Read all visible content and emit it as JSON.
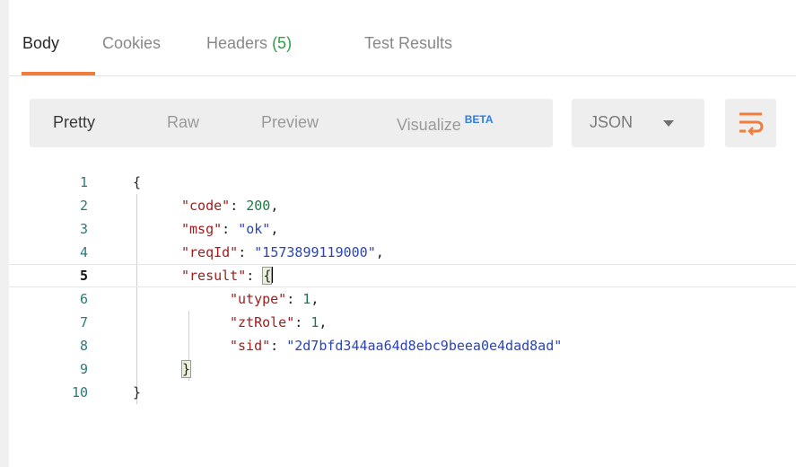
{
  "tabs": [
    {
      "label": "Body",
      "active": true
    },
    {
      "label": "Cookies",
      "active": false
    },
    {
      "label": "Headers",
      "count": "(5)",
      "active": false
    },
    {
      "label": "Test Results",
      "active": false
    }
  ],
  "view_modes": [
    {
      "label": "Pretty",
      "active": true
    },
    {
      "label": "Raw",
      "active": false
    },
    {
      "label": "Preview",
      "active": false
    },
    {
      "label": "Visualize",
      "badge": "BETA",
      "active": false
    }
  ],
  "format_select": {
    "value": "JSON",
    "icon": "chevron-down-icon"
  },
  "wrap_button": {
    "icon": "wrap-lines-icon"
  },
  "colors": {
    "accent": "#ef7d3c",
    "beta": "#2f7de1",
    "count": "#2f9e44"
  },
  "editor": {
    "current_line": 5,
    "lines": [
      {
        "num": "1",
        "parts": [
          {
            "t": "{",
            "c": "punc"
          }
        ]
      },
      {
        "num": "2",
        "parts": [
          {
            "t": "\"code\"",
            "c": "key"
          },
          {
            "t": ": ",
            "c": "punc"
          },
          {
            "t": "200",
            "c": "num-v"
          },
          {
            "t": ",",
            "c": "punc"
          }
        ]
      },
      {
        "num": "3",
        "parts": [
          {
            "t": "\"msg\"",
            "c": "key"
          },
          {
            "t": ": ",
            "c": "punc"
          },
          {
            "t": "\"ok\"",
            "c": "str"
          },
          {
            "t": ",",
            "c": "punc"
          }
        ]
      },
      {
        "num": "4",
        "parts": [
          {
            "t": "\"reqId\"",
            "c": "key"
          },
          {
            "t": ": ",
            "c": "punc"
          },
          {
            "t": "\"1573899119000\"",
            "c": "str"
          },
          {
            "t": ",",
            "c": "punc"
          }
        ]
      },
      {
        "num": "5",
        "parts": [
          {
            "t": "\"result\"",
            "c": "key"
          },
          {
            "t": ": ",
            "c": "punc"
          },
          {
            "t": "{",
            "c": "brace"
          }
        ]
      },
      {
        "num": "6",
        "parts": [
          {
            "t": "\"utype\"",
            "c": "key"
          },
          {
            "t": ": ",
            "c": "punc"
          },
          {
            "t": "1",
            "c": "num-v"
          },
          {
            "t": ",",
            "c": "punc"
          }
        ]
      },
      {
        "num": "7",
        "parts": [
          {
            "t": "\"ztRole\"",
            "c": "key"
          },
          {
            "t": ": ",
            "c": "punc"
          },
          {
            "t": "1",
            "c": "num-v"
          },
          {
            "t": ",",
            "c": "punc"
          }
        ]
      },
      {
        "num": "8",
        "parts": [
          {
            "t": "\"sid\"",
            "c": "key"
          },
          {
            "t": ": ",
            "c": "punc"
          },
          {
            "t": "\"2d7bfd344aa64d8ebc9beea0e4dad8ad\"",
            "c": "str"
          }
        ]
      },
      {
        "num": "9",
        "parts": [
          {
            "t": "}",
            "c": "brace"
          }
        ]
      },
      {
        "num": "10",
        "parts": [
          {
            "t": "}",
            "c": "punc"
          }
        ]
      }
    ]
  }
}
